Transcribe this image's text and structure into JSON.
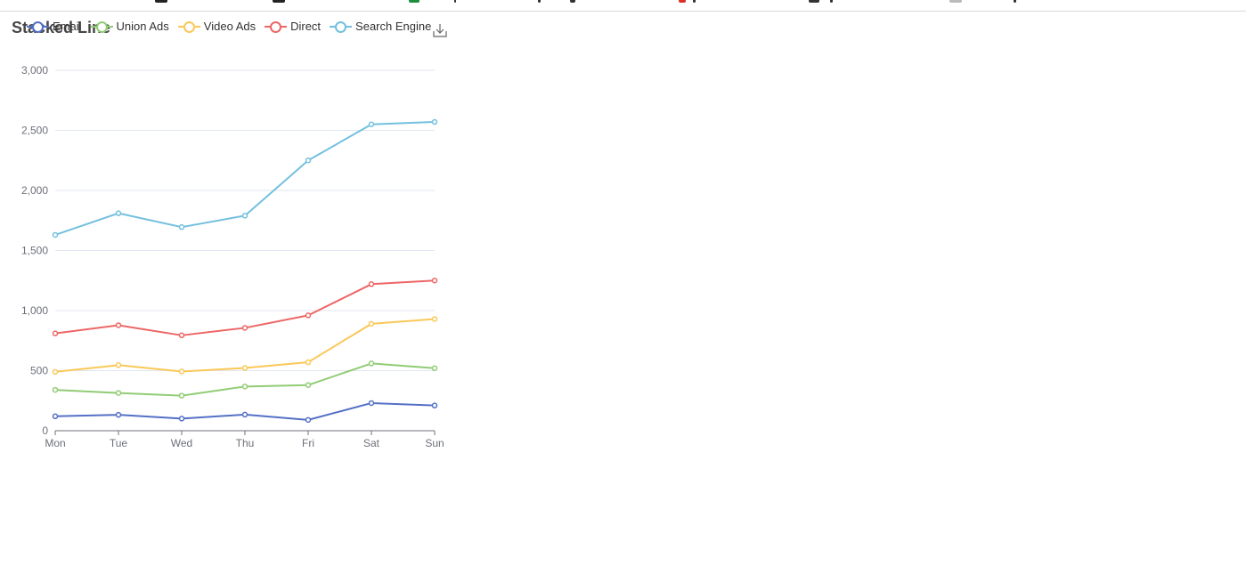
{
  "chart_data": {
    "type": "line",
    "title": "Stacked Line",
    "stacked": true,
    "categories": [
      "Mon",
      "Tue",
      "Wed",
      "Thu",
      "Fri",
      "Sat",
      "Sun"
    ],
    "series": [
      {
        "name": "Email",
        "color": "#5470c6",
        "values": [
          120,
          132,
          101,
          134,
          90,
          230,
          210
        ]
      },
      {
        "name": "Union Ads",
        "color": "#91cc75",
        "values": [
          220,
          182,
          191,
          234,
          290,
          330,
          310
        ]
      },
      {
        "name": "Video Ads",
        "color": "#fac858",
        "values": [
          150,
          232,
          201,
          154,
          190,
          330,
          410
        ]
      },
      {
        "name": "Direct",
        "color": "#ee6666",
        "values": [
          320,
          332,
          301,
          334,
          390,
          330,
          320
        ]
      },
      {
        "name": "Search Engine",
        "color": "#73c0de",
        "values": [
          820,
          932,
          901,
          934,
          1290,
          1330,
          1320
        ]
      }
    ],
    "yticks": [
      "0",
      "500",
      "1,000",
      "1,500",
      "2,000",
      "2,500",
      "3,000"
    ],
    "ylim": [
      0,
      3000
    ],
    "grid": true,
    "legend_position": "top"
  },
  "toolbox": {
    "save_icon": "download-icon"
  }
}
